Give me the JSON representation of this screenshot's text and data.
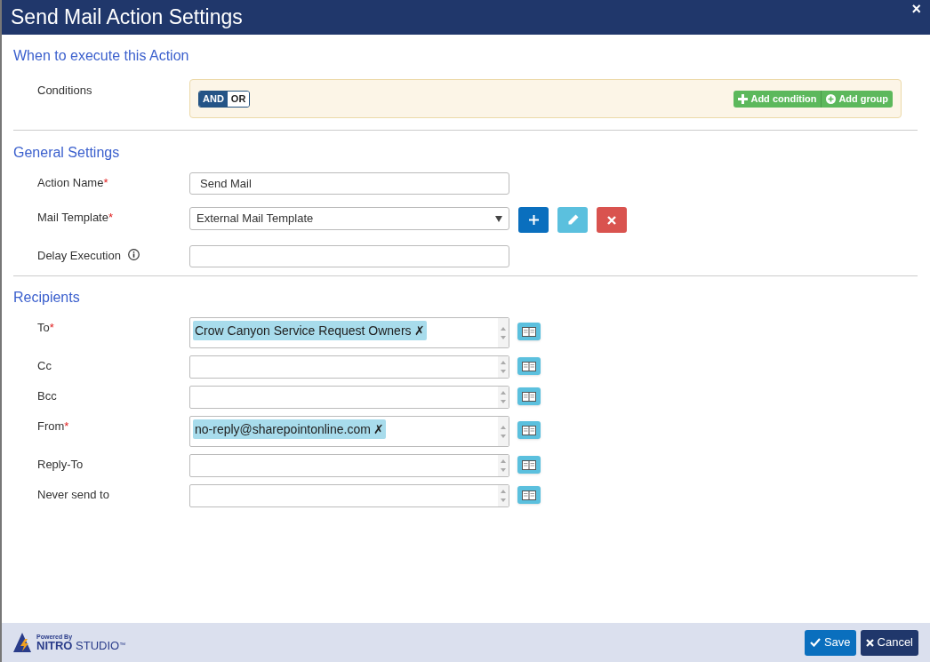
{
  "window": {
    "title": "Send Mail Action Settings",
    "close": "×"
  },
  "when_section": {
    "heading": "When to execute this Action",
    "conditions_label": "Conditions",
    "logic": [
      {
        "label": "AND",
        "selected": true
      },
      {
        "label": "OR",
        "selected": false
      }
    ],
    "buttons": [
      {
        "label": "Add condition",
        "kind": "plus"
      },
      {
        "label": "Add group",
        "kind": "circle-plus"
      }
    ]
  },
  "general_section": {
    "heading": "General Settings",
    "fields": [
      {
        "label": "Action Name",
        "asterisk": "*",
        "kind": "text",
        "value": "Send Mail"
      },
      {
        "label": "Mail Template",
        "asterisk": "*",
        "kind": "select",
        "value": "External Mail Template"
      },
      {
        "label": "Delay Execution",
        "kind": "info"
      }
    ]
  },
  "recipients_section": {
    "heading": "Recipients",
    "fields": [
      {
        "label": "To",
        "asterisk": "*",
        "tokens": [
          {
            "text": "Crow Canyon Service Request Owners",
            "remove": "✗"
          }
        ]
      },
      {
        "label": "Cc"
      },
      {
        "label": "Bcc"
      },
      {
        "label": "From",
        "asterisk": "*",
        "tokens": [
          {
            "text": "no-reply@sharepointonline.com",
            "remove": "✗"
          }
        ]
      },
      {
        "label": "Reply-To"
      },
      {
        "label": "Never send to"
      }
    ]
  },
  "footer": {
    "powered_by": "Powered By",
    "brand_bold": "NITRO",
    "brand": "STUDIO",
    "trademark": "™",
    "buttons": [
      {
        "label": "Save",
        "kind": "save"
      },
      {
        "label": "Cancel",
        "kind": "cancel"
      }
    ]
  }
}
